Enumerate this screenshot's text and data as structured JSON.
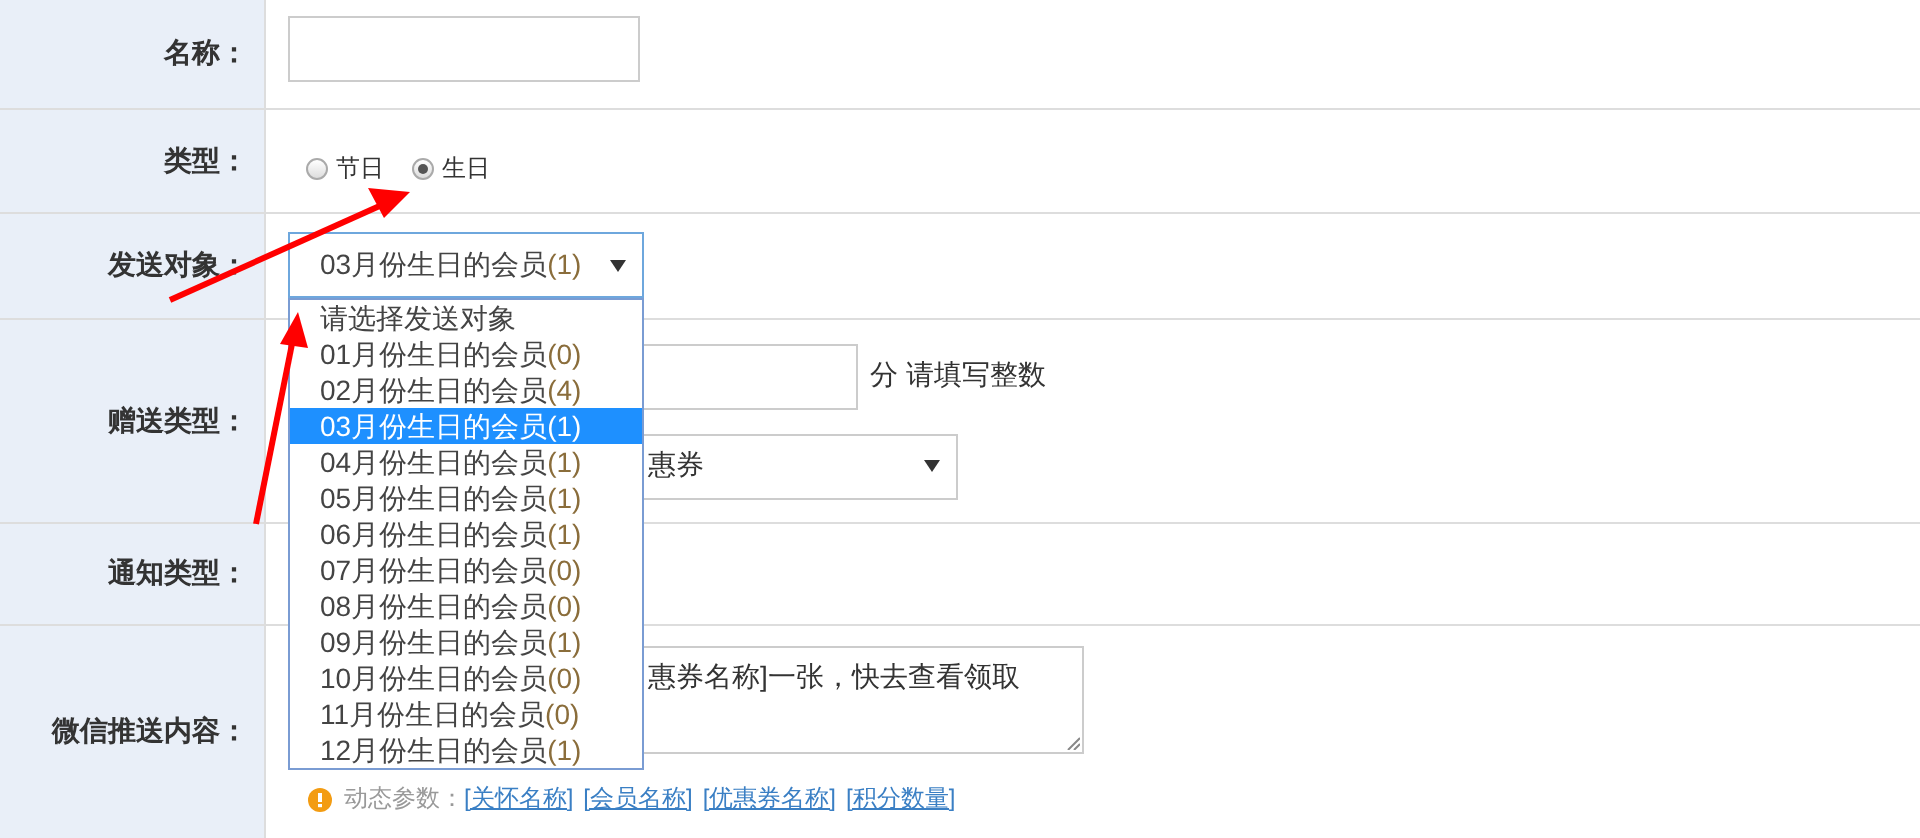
{
  "form": {
    "name": {
      "label": "名称："
    },
    "type": {
      "label": "类型：",
      "options": [
        {
          "label": "节日",
          "selected": false
        },
        {
          "label": "生日",
          "selected": true
        }
      ]
    },
    "target": {
      "label": "发送对象：",
      "value": "03月份生日的会员",
      "value_count": "(1)",
      "expanded": true,
      "options": [
        {
          "label": "请选择发送对象",
          "selected": false
        },
        {
          "label": "01月份生日的会员",
          "count": "(0)",
          "selected": false
        },
        {
          "label": "02月份生日的会员",
          "count": "(4)",
          "selected": false
        },
        {
          "label": "03月份生日的会员",
          "count": "(1)",
          "selected": true
        },
        {
          "label": "04月份生日的会员",
          "count": "(1)",
          "selected": false
        },
        {
          "label": "05月份生日的会员",
          "count": "(1)",
          "selected": false
        },
        {
          "label": "06月份生日的会员",
          "count": "(1)",
          "selected": false
        },
        {
          "label": "07月份生日的会员",
          "count": "(0)",
          "selected": false
        },
        {
          "label": "08月份生日的会员",
          "count": "(0)",
          "selected": false
        },
        {
          "label": "09月份生日的会员",
          "count": "(1)",
          "selected": false
        },
        {
          "label": "10月份生日的会员",
          "count": "(0)",
          "selected": false
        },
        {
          "label": "11月份生日的会员",
          "count": "(0)",
          "selected": false
        },
        {
          "label": "12月份生日的会员",
          "count": "(1)",
          "selected": false
        }
      ]
    },
    "gift": {
      "label": "赠送类型：",
      "points_unit": "分",
      "points_hint": "请填写整数",
      "coupon_select": "惠券"
    },
    "notice": {
      "label": "通知类型："
    },
    "wechat": {
      "label": "微信推送内容：",
      "content": "惠券名称]一张，快去查看领取",
      "params_label": "动态参数：",
      "params": [
        "[关怀名称]",
        "[会员名称]",
        "[优惠券名称]",
        "[积分数量]"
      ]
    }
  }
}
